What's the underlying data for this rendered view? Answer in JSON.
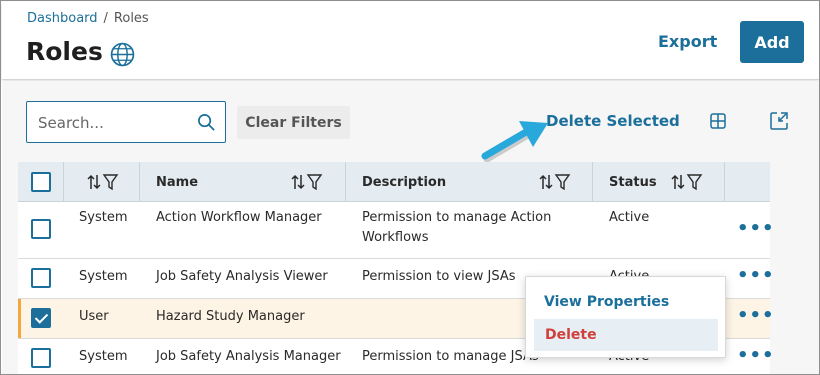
{
  "breadcrumb": {
    "home": "Dashboard",
    "separator": "/",
    "current": "Roles"
  },
  "page": {
    "title": "Roles",
    "title_icon": "globe-icon"
  },
  "actions": {
    "export": "Export",
    "add": "Add"
  },
  "toolbar": {
    "search_placeholder": "Search...",
    "clear_filters": "Clear Filters",
    "delete_selected": "Delete Selected",
    "grid_icon": "grid-icon",
    "collapse_icon": "collapse-icon"
  },
  "table": {
    "columns": [
      {
        "key": "type",
        "label": ""
      },
      {
        "key": "name",
        "label": "Name"
      },
      {
        "key": "description",
        "label": "Description"
      },
      {
        "key": "status",
        "label": "Status"
      }
    ],
    "rows": [
      {
        "checked": false,
        "type": "System",
        "name": "Action Workflow Manager",
        "description_line1": "Permission to manage Action",
        "description_line2": "Workflows",
        "status": "Active"
      },
      {
        "checked": false,
        "type": "System",
        "name": "Job Safety Analysis Viewer",
        "description_line1": "Permission to view JSAs",
        "description_line2": "",
        "status": "Active"
      },
      {
        "checked": true,
        "type": "User",
        "name": "Hazard Study Manager",
        "description_line1": "",
        "description_line2": "",
        "status": ""
      },
      {
        "checked": false,
        "type": "System",
        "name": "Job Safety Analysis Manager",
        "description_line1": "Permission to manage JSAs",
        "description_line2": "",
        "status": "Active"
      }
    ],
    "row_actions": "•••"
  },
  "context_menu": {
    "view_properties": "View Properties",
    "delete": "Delete"
  },
  "colors": {
    "accent": "#1b6f9a",
    "danger": "#d0403a",
    "selected_row": "#fdf4e5",
    "selected_marker": "#f2a83b",
    "annotation_arrow": "#29a8db"
  }
}
